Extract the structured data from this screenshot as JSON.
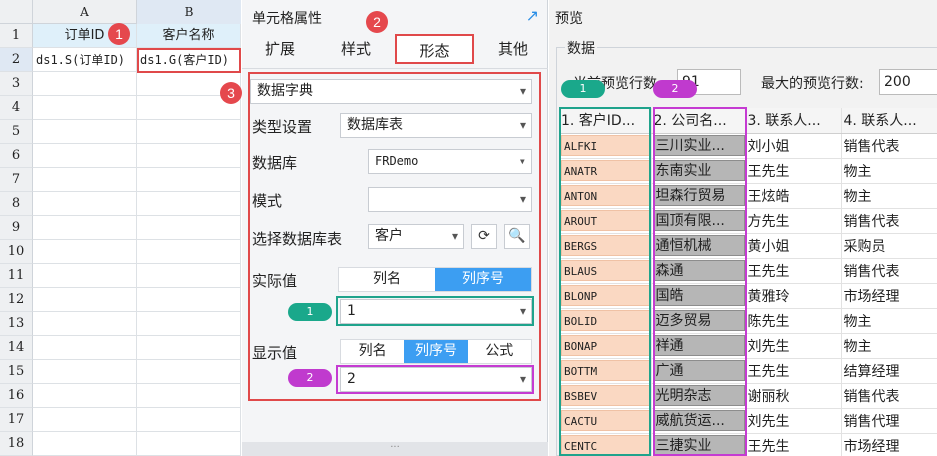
{
  "sheet": {
    "col_headers": [
      "A",
      "B"
    ],
    "row_numbers": [
      "1",
      "2",
      "3",
      "4",
      "5",
      "6",
      "7",
      "8",
      "9",
      "10",
      "11",
      "12",
      "13",
      "14",
      "15",
      "16",
      "17",
      "18"
    ],
    "row1": {
      "a": "订单ID",
      "b": "客户名称"
    },
    "row2": {
      "a": "ds1.S(订单ID)",
      "b": "ds1.G(客户ID)"
    }
  },
  "props": {
    "title": "单元格属性",
    "tabs": [
      "扩展",
      "样式",
      "形态",
      "其他"
    ],
    "active_tab": "形态",
    "form_type": "数据字典",
    "type_label": "类型设置",
    "type_value": "数据库表",
    "db_label": "数据库",
    "db_value": "FRDemo",
    "schema_label": "模式",
    "schema_value": "",
    "table_label": "选择数据库表",
    "table_value": "客户",
    "actual_label": "实际值",
    "actual_seg": [
      "列名",
      "列序号"
    ],
    "actual_value": "1",
    "display_label": "显示值",
    "display_seg": [
      "列名",
      "列序号",
      "公式"
    ],
    "display_value": "2"
  },
  "badges": {
    "one": "1",
    "two": "2",
    "three": "3"
  },
  "pills": {
    "one": "1",
    "two": "2"
  },
  "preview": {
    "title": "预览",
    "group_label": "数据",
    "current_rows_label": "当前预览行数:",
    "current_rows": "91",
    "max_rows_label": "最大的预览行数:",
    "max_rows": "200",
    "columns": [
      "1. 客户ID...",
      "2. 公司名...",
      "3. 联系人...",
      "4. 联系人..."
    ],
    "rows": [
      [
        "ALFKI",
        "三川实业...",
        "刘小姐",
        "销售代表"
      ],
      [
        "ANATR",
        "东南实业",
        "王先生",
        "物主"
      ],
      [
        "ANTON",
        "坦森行贸易",
        "王炫皓",
        "物主"
      ],
      [
        "AROUT",
        "国顶有限...",
        "方先生",
        "销售代表"
      ],
      [
        "BERGS",
        "通恒机械",
        "黄小姐",
        "采购员"
      ],
      [
        "BLAUS",
        "森通",
        "王先生",
        "销售代表"
      ],
      [
        "BLONP",
        "国皓",
        "黄雅玲",
        "市场经理"
      ],
      [
        "BOLID",
        "迈多贸易",
        "陈先生",
        "物主"
      ],
      [
        "BONAP",
        "祥通",
        "刘先生",
        "物主"
      ],
      [
        "BOTTM",
        "广通",
        "王先生",
        "结算经理"
      ],
      [
        "BSBEV",
        "光明杂志",
        "谢丽秋",
        "销售代表"
      ],
      [
        "CACTU",
        "威航货运...",
        "刘先生",
        "销售代理"
      ],
      [
        "CENTC",
        "三捷实业",
        "王先生",
        "市场经理"
      ]
    ]
  },
  "colors": {
    "red": "#e0494a",
    "teal": "#1fa38c",
    "magenta": "#c53bd2",
    "accent": "#3c9ef2"
  }
}
